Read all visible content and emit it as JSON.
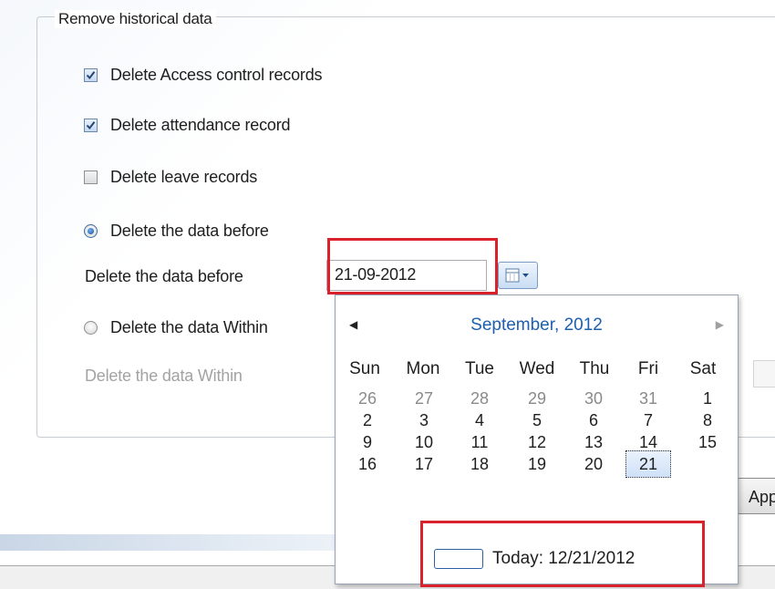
{
  "group": {
    "title": "Remove historical data"
  },
  "options": {
    "delete_access": {
      "label": "Delete Access control records",
      "checked": true
    },
    "delete_attendance": {
      "label": "Delete  attendance record",
      "checked": true
    },
    "delete_leave": {
      "label": "Delete leave records",
      "checked": false
    },
    "radio_before": {
      "label": "Delete the data  before",
      "selected": true
    },
    "radio_within": {
      "label": "Delete the data Within",
      "selected": false
    }
  },
  "before_field": {
    "label": "Delete the data  before",
    "value": "21-09-2012"
  },
  "within_field": {
    "label": "Delete the data Within"
  },
  "apply_button": {
    "label": "Apply"
  },
  "calendar": {
    "month_label": "September, 2012",
    "weekdays": [
      "Sun",
      "Mon",
      "Tue",
      "Wed",
      "Thu",
      "Fri",
      "Sat"
    ],
    "weeks": [
      [
        "26",
        "27",
        "28",
        "29",
        "30",
        "31",
        "1"
      ],
      [
        "2",
        "3",
        "4",
        "5",
        "6",
        "7",
        "8"
      ],
      [
        "9",
        "10",
        "11",
        "12",
        "13",
        "14",
        "15"
      ],
      [
        "16",
        "17",
        "18",
        "19",
        "20",
        "21",
        ""
      ]
    ],
    "selected_day": "21",
    "today_label": "Today: 12/21/2012"
  },
  "colors": {
    "highlight_red": "#d9222b",
    "month_blue": "#1e5fb0"
  }
}
